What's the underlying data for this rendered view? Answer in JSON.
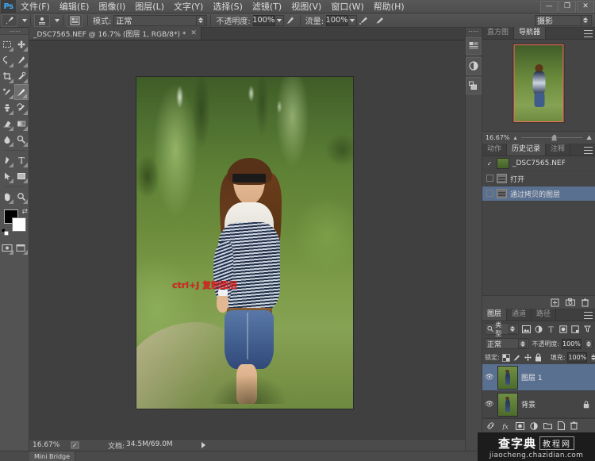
{
  "app": {
    "name": "Ps",
    "logo_color": "#3fa9f5"
  },
  "menubar": {
    "items": [
      {
        "label": "文件(F)"
      },
      {
        "label": "编辑(E)"
      },
      {
        "label": "图像(I)"
      },
      {
        "label": "图层(L)"
      },
      {
        "label": "文字(Y)"
      },
      {
        "label": "选择(S)"
      },
      {
        "label": "滤镜(T)"
      },
      {
        "label": "视图(V)"
      },
      {
        "label": "窗口(W)"
      },
      {
        "label": "帮助(H)"
      }
    ],
    "window_buttons": [
      {
        "name": "minimize",
        "glyph": "—"
      },
      {
        "name": "maximize",
        "glyph": "❐"
      },
      {
        "name": "close",
        "glyph": "✕"
      }
    ]
  },
  "options_bar": {
    "tool_icon": "brush-tool-icon",
    "brush_preset_label": "",
    "mode_label": "模式:",
    "mode_value": "正常",
    "opacity_label": "不透明度:",
    "opacity_value": "100%",
    "flow_label": "流量:",
    "flow_value": "100%",
    "airbrush_icon": "airbrush-icon",
    "tablet_pressure_icon": "tablet-pressure-icon",
    "workspace_value": "摄影"
  },
  "toolbox": {
    "tools": [
      {
        "name": "marquee-tool",
        "glyph": "▭"
      },
      {
        "name": "move-tool",
        "glyph": "✥"
      },
      {
        "name": "lasso-tool",
        "glyph": "◯"
      },
      {
        "name": "quick-selection-tool",
        "glyph": "✎"
      },
      {
        "name": "crop-tool",
        "glyph": "⌗"
      },
      {
        "name": "eyedropper-tool",
        "glyph": "⚲"
      },
      {
        "name": "spot-healing-tool",
        "glyph": "✂"
      },
      {
        "name": "brush-tool",
        "glyph": "🖌",
        "selected": true
      },
      {
        "name": "clone-stamp-tool",
        "glyph": "⚑"
      },
      {
        "name": "history-brush-tool",
        "glyph": "⟲"
      },
      {
        "name": "eraser-tool",
        "glyph": "▰"
      },
      {
        "name": "gradient-tool",
        "glyph": "▤"
      },
      {
        "name": "blur-tool",
        "glyph": "💧"
      },
      {
        "name": "dodge-tool",
        "glyph": "⚭"
      },
      {
        "name": "pen-tool",
        "glyph": "✒"
      },
      {
        "name": "type-tool",
        "glyph": "T"
      },
      {
        "name": "path-selection-tool",
        "glyph": "➤"
      },
      {
        "name": "rectangle-tool",
        "glyph": "▢"
      },
      {
        "name": "hand-tool",
        "glyph": "✋"
      },
      {
        "name": "zoom-tool",
        "glyph": "🔍"
      }
    ],
    "foreground_color": "#000000",
    "background_color": "#ffffff",
    "swap_colors_icon": "swap-colors-icon",
    "default_colors_icon": "default-colors-icon",
    "quick_mask_icon": "quick-mask-icon",
    "screen_mode_icon": "screen-mode-icon"
  },
  "document": {
    "tab_title": "_DSC7565.NEF @ 16.7% (图层 1, RGB/8*) *",
    "close_glyph": "✕",
    "annotation": "ctrl+J 复制图层",
    "annotation_color": "#e02020"
  },
  "status_bar": {
    "zoom": "16.67%",
    "doc_label": "文档:",
    "doc_size": "34.5M/69.0M"
  },
  "minibridge": {
    "tab_label": "Mini Bridge"
  },
  "vdock": {
    "buttons": [
      {
        "name": "color-panel-icon"
      },
      {
        "name": "adjustments-panel-icon"
      },
      {
        "name": "styles-panel-icon"
      }
    ]
  },
  "navigator_panel": {
    "tabs": [
      {
        "label": "直方图",
        "active": false
      },
      {
        "label": "导航器",
        "active": true
      }
    ],
    "menu_icon": "panel-menu-icon",
    "zoom_value": "16.67%",
    "zoom_out_icon": "zoom-out-icon",
    "zoom_in_icon": "zoom-in-icon"
  },
  "history_panel": {
    "tabs": [
      {
        "label": "动作",
        "active": false
      },
      {
        "label": "历史记录",
        "active": true
      },
      {
        "label": "注释",
        "active": false
      }
    ],
    "menu_icon": "panel-menu-icon",
    "snapshot": {
      "label": "_DSC7565.NEF"
    },
    "states": [
      {
        "label": "打开",
        "selected": false
      },
      {
        "label": "通过拷贝的图层",
        "selected": true
      }
    ],
    "footer_icons": [
      {
        "name": "create-document-from-state-icon",
        "glyph": "▣"
      },
      {
        "name": "create-snapshot-icon",
        "glyph": "📷"
      },
      {
        "name": "delete-state-icon",
        "glyph": "🗑"
      }
    ]
  },
  "layers_panel": {
    "tabs": [
      {
        "label": "图层",
        "active": true
      },
      {
        "label": "通道",
        "active": false
      },
      {
        "label": "路径",
        "active": false
      }
    ],
    "menu_icon": "panel-menu-icon",
    "filter_kind_label": "类型",
    "filter_icons": [
      {
        "name": "filter-pixel-icon",
        "glyph": "▣"
      },
      {
        "name": "filter-adjustment-icon",
        "glyph": "◐"
      },
      {
        "name": "filter-type-icon",
        "glyph": "T"
      },
      {
        "name": "filter-shape-icon",
        "glyph": "▧"
      },
      {
        "name": "filter-smart-object-icon",
        "glyph": "◎"
      }
    ],
    "filter_toggle_icon": "filter-toggle-icon",
    "blend_mode": "正常",
    "opacity_label": "不透明度:",
    "opacity_value": "100%",
    "lock_label": "锁定:",
    "lock_icons": [
      {
        "name": "lock-transparency-icon",
        "glyph": "▨"
      },
      {
        "name": "lock-image-icon",
        "glyph": "🖌"
      },
      {
        "name": "lock-position-icon",
        "glyph": "✛"
      },
      {
        "name": "lock-all-icon",
        "glyph": "🔒"
      }
    ],
    "fill_label": "填充:",
    "fill_value": "100%",
    "layers": [
      {
        "name": "图层 1",
        "visible": true,
        "selected": true,
        "locked": false
      },
      {
        "name": "背景",
        "visible": true,
        "selected": false,
        "locked": true,
        "lock_glyph": "🔒"
      }
    ],
    "footer_icons": [
      {
        "name": "link-layers-icon",
        "glyph": "🔗"
      },
      {
        "name": "layer-style-icon",
        "glyph": "fx"
      },
      {
        "name": "add-layer-mask-icon",
        "glyph": "▣"
      },
      {
        "name": "new-adjustment-layer-icon",
        "glyph": "◐"
      },
      {
        "name": "new-group-icon",
        "glyph": "🗀"
      },
      {
        "name": "new-layer-icon",
        "glyph": "🗋"
      },
      {
        "name": "delete-layer-icon",
        "glyph": "🗑"
      }
    ]
  },
  "watermark": {
    "main": "查字典",
    "boxed": "教程网",
    "url": "jiaocheng.chazidian.com"
  }
}
